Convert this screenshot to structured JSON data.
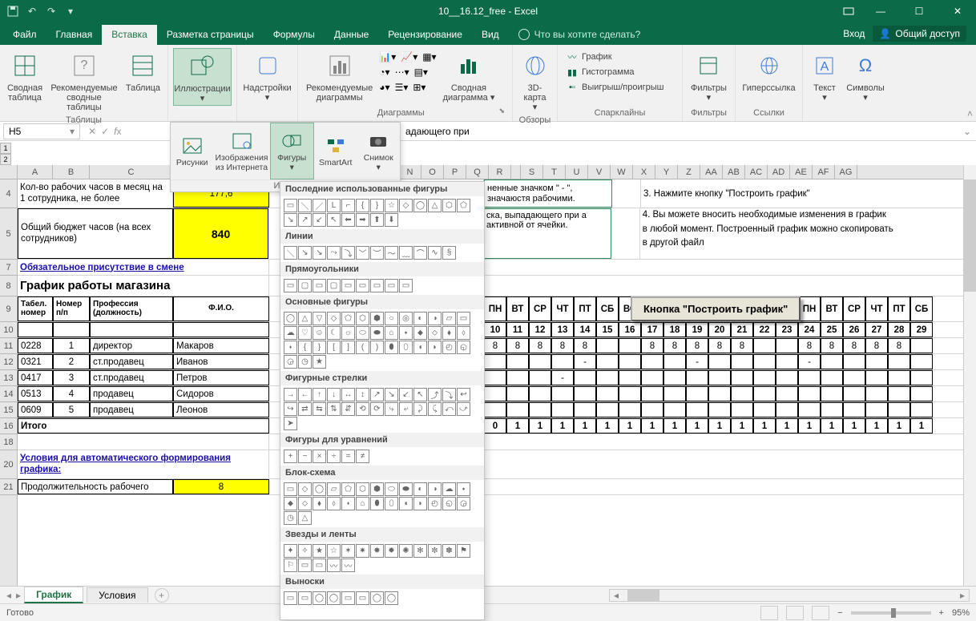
{
  "titlebar": {
    "title": "10__16.12_free - Excel"
  },
  "menubar": {
    "tabs": [
      "Файл",
      "Главная",
      "Вставка",
      "Разметка страницы",
      "Формулы",
      "Данные",
      "Рецензирование",
      "Вид"
    ],
    "active_index": 2,
    "tellme": "Что вы хотите сделать?",
    "login": "Вход",
    "share": "Общий доступ"
  },
  "ribbon": {
    "groups": {
      "tables": {
        "label": "Таблицы",
        "pivot": "Сводная\nтаблица",
        "rec": "Рекомендуемые\nсводные таблицы",
        "table": "Таблица"
      },
      "illus": {
        "label": "Иллю",
        "btn": "Иллюстрации"
      },
      "addins": {
        "btn": "Надстройки"
      },
      "charts": {
        "label": "Диаграммы",
        "rec": "Рекомендуемые\nдиаграммы",
        "pivot": "Сводная\nдиаграмма",
        "map3d": "3D-\nкарта",
        "tours": "Обзоры"
      },
      "spark": {
        "label": "Спарклайны",
        "line": "График",
        "hist": "Гистограмма",
        "winloss": "Выигрыш/проигрыш"
      },
      "filters": {
        "label": "Фильтры",
        "btn": "Фильтры"
      },
      "links": {
        "label": "Ссылки",
        "btn": "Гиперссылка"
      },
      "text": {
        "btn": "Текст"
      },
      "symbols": {
        "btn": "Символы"
      }
    }
  },
  "illus_panel": {
    "items": [
      "Рисунки",
      "Изображения\nиз Интернета",
      "Фигуры",
      "SmartArt",
      "Снимок"
    ],
    "selected_index": 2,
    "caption": "Иллю"
  },
  "shapes": {
    "sections": [
      "Последние использованные фигуры",
      "Линии",
      "Прямоугольники",
      "Основные фигуры",
      "Фигурные стрелки",
      "Фигуры для уравнений",
      "Блок-схема",
      "Звезды и ленты",
      "Выноски"
    ]
  },
  "formula_bar": {
    "namebox": "H5",
    "formula_fragment": "адающего при"
  },
  "columns": [
    "A",
    "B",
    "C",
    "D",
    "",
    "",
    "",
    "",
    "",
    "",
    "",
    "",
    "",
    "N",
    "O",
    "P",
    "Q",
    "R",
    "",
    "S",
    "T",
    "U",
    "V",
    "W",
    "X",
    "Y",
    "Z",
    "AA",
    "AB",
    "AC",
    "AD",
    "AE",
    "AF",
    "AG"
  ],
  "rows_visible": [
    4,
    5,
    7,
    8,
    9,
    10,
    11,
    12,
    13,
    14,
    15,
    16,
    18,
    20
  ],
  "cells": {
    "r4_label": "Кол-во рабочих часов в месяц на 1 сотрудника, не более",
    "r4_val": "177,6",
    "r5_label": "Общий бюджет часов (на всех сотрудников)",
    "r5_val": "840",
    "r7": "Обязательное присутствие в смене",
    "r8": "График работы магазина",
    "headers": [
      "Табел. номер",
      "Номер п/п",
      "Профессия (должность)",
      "Ф.И.О."
    ],
    "staff": [
      {
        "tab": "0228",
        "num": "1",
        "job": "директор",
        "name": "Макаров"
      },
      {
        "tab": "0321",
        "num": "2",
        "job": "ст.продавец",
        "name": "Иванов"
      },
      {
        "tab": "0417",
        "num": "3",
        "job": "ст.продавец",
        "name": "Петров"
      },
      {
        "tab": "0513",
        "num": "4",
        "job": "продавец",
        "name": "Сидоров"
      },
      {
        "tab": "0609",
        "num": "5",
        "job": "продавец",
        "name": "Леонов"
      }
    ],
    "r16": "Итого",
    "r20a": "Условия для автоматического формирования графика:",
    "r21a": "Продолжительность рабочего",
    "r21_val": "8",
    "right_text1": "ненные значком \" - \", значаюстя рабочими.",
    "right_text2": "ска, выпадающего при а активной от ячейки.",
    "right_step3": "3. Нажмите кнопку \"Построить график\"",
    "right_step4a": "4. Вы можете вносить необходимые изменения в график",
    "right_step4b": "в любой момент. Построенный график можно скопировать",
    "right_step4c": "в другой файл",
    "build_btn": "Кнопка \"Построить график\""
  },
  "schedule": {
    "days": [
      "ПН",
      "ВТ",
      "СР",
      "ЧТ",
      "ПТ",
      "СБ",
      "ВС",
      "ПН",
      "ВТ",
      "СР",
      "ЧТ",
      "ПТ",
      "СБ",
      "ВС",
      "ПН",
      "ВТ",
      "СР",
      "ЧТ",
      "ПТ",
      "СБ"
    ],
    "nums": [
      "10",
      "11",
      "12",
      "13",
      "14",
      "15",
      "16",
      "17",
      "18",
      "19",
      "20",
      "21",
      "22",
      "23",
      "24",
      "25",
      "26",
      "27",
      "28",
      "29"
    ],
    "row11": [
      "8",
      "8",
      "8",
      "8",
      "8",
      "",
      "",
      "8",
      "8",
      "8",
      "8",
      "8",
      "",
      "",
      "8",
      "8",
      "8",
      "8",
      "8",
      ""
    ],
    "row12": [
      "",
      "",
      "",
      "",
      "-",
      "",
      "",
      "",
      "",
      "-",
      "",
      "",
      "",
      "",
      "-",
      "",
      "",
      "",
      "",
      ""
    ],
    "row13": [
      "",
      "",
      "",
      "-",
      "",
      "",
      "",
      "",
      "",
      "",
      "",
      "",
      "",
      "",
      "",
      "",
      "",
      "",
      "",
      ""
    ],
    "row14": [
      "",
      "",
      "",
      "",
      "",
      "",
      "",
      "",
      "",
      "",
      "",
      "",
      "",
      "",
      "",
      "",
      "",
      "",
      "",
      ""
    ],
    "row15": [
      "",
      "",
      "",
      "",
      "",
      "",
      "",
      "",
      "",
      "",
      "",
      "",
      "",
      "",
      "",
      "",
      "",
      "",
      "",
      ""
    ],
    "row16": [
      "0",
      "1",
      "1",
      "1",
      "1",
      "1",
      "1",
      "1",
      "1",
      "1",
      "1",
      "1",
      "1",
      "1",
      "1",
      "1",
      "1",
      "1",
      "1",
      "1"
    ]
  },
  "sheet_tabs": {
    "tabs": [
      "График",
      "Условия"
    ],
    "active_index": 0
  },
  "statusbar": {
    "ready": "Готово",
    "zoom": "95%"
  }
}
